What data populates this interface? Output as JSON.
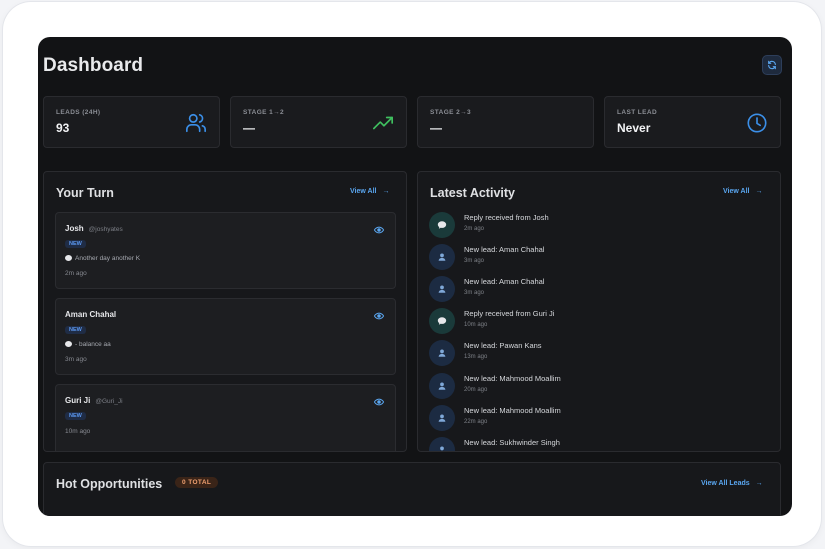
{
  "header": {
    "title": "Dashboard",
    "refresh_icon": "refresh-icon"
  },
  "stats": [
    {
      "label": "LEADS (24H)",
      "value": "93",
      "icon": "users-icon",
      "color": "#3b8fe8"
    },
    {
      "label": "STAGE 1→2",
      "value": "—",
      "icon": "trending-up-icon",
      "color": "#3fbf5f"
    },
    {
      "label": "STAGE 2→3",
      "value": "—",
      "icon": "",
      "color": ""
    },
    {
      "label": "LAST LEAD",
      "value": "Never",
      "icon": "clock-icon",
      "color": "#3b8fe8"
    }
  ],
  "your_turn": {
    "title": "Your Turn",
    "view_all": "View All",
    "cards": [
      {
        "name": "Josh",
        "handle": "@joshyates",
        "badge": "NEW",
        "message": "Another day another K",
        "time": "2m ago"
      },
      {
        "name": "Aman Chahal",
        "handle": "",
        "badge": "NEW",
        "message": "- balance aa",
        "time": "3m ago"
      },
      {
        "name": "Guri Ji",
        "handle": "@Guri_Ji",
        "badge": "NEW",
        "message": "",
        "time": "10m ago"
      }
    ]
  },
  "latest_activity": {
    "title": "Latest Activity",
    "view_all": "View All",
    "items": [
      {
        "type": "reply",
        "text": "Reply received from Josh",
        "time": "2m ago"
      },
      {
        "type": "lead",
        "text": "New lead: Aman Chahal",
        "time": "3m ago"
      },
      {
        "type": "lead",
        "text": "New lead: Aman Chahal",
        "time": "3m ago"
      },
      {
        "type": "reply",
        "text": "Reply received from Guri Ji",
        "time": "10m ago"
      },
      {
        "type": "lead",
        "text": "New lead: Pawan Kans",
        "time": "13m ago"
      },
      {
        "type": "lead",
        "text": "New lead: Mahmood Moallim",
        "time": "20m ago"
      },
      {
        "type": "lead",
        "text": "New lead: Mahmood Moallim",
        "time": "22m ago"
      },
      {
        "type": "lead",
        "text": "New lead: Sukhwinder Singh",
        "time": ""
      }
    ]
  },
  "hot": {
    "title": "Hot Opportunities",
    "badge": "0 TOTAL",
    "view_all": "View All Leads"
  }
}
